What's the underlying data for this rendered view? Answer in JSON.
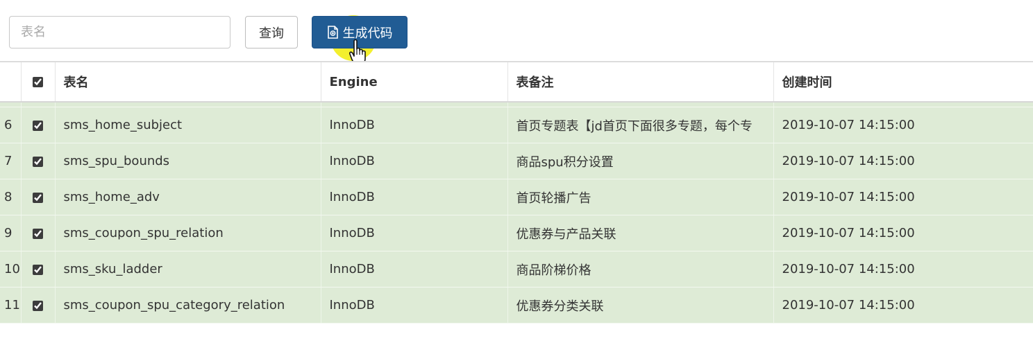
{
  "toolbar": {
    "search_placeholder": "表名",
    "query_label": "查询",
    "generate_label": "生成代码",
    "generate_icon": "document-code-icon",
    "highlight_color": "#f0eb00",
    "button_primary_color": "#215c94"
  },
  "table": {
    "headers": {
      "name": "表名",
      "engine": "Engine",
      "comment": "表备注",
      "created": "创建时间"
    },
    "header_checkbox_checked": true,
    "row_color": "#deebd6",
    "rows": [
      {
        "index": "6",
        "checked": true,
        "name": "sms_home_subject",
        "engine": "InnoDB",
        "comment": "首页专题表【jd首页下面很多专题，每个专",
        "created": "2019-10-07 14:15:00"
      },
      {
        "index": "7",
        "checked": true,
        "name": "sms_spu_bounds",
        "engine": "InnoDB",
        "comment": "商品spu积分设置",
        "created": "2019-10-07 14:15:00"
      },
      {
        "index": "8",
        "checked": true,
        "name": "sms_home_adv",
        "engine": "InnoDB",
        "comment": "首页轮播广告",
        "created": "2019-10-07 14:15:00"
      },
      {
        "index": "9",
        "checked": true,
        "name": "sms_coupon_spu_relation",
        "engine": "InnoDB",
        "comment": "优惠券与产品关联",
        "created": "2019-10-07 14:15:00"
      },
      {
        "index": "10",
        "checked": true,
        "name": "sms_sku_ladder",
        "engine": "InnoDB",
        "comment": "商品阶梯价格",
        "created": "2019-10-07 14:15:00"
      },
      {
        "index": "11",
        "checked": true,
        "name": "sms_coupon_spu_category_relation",
        "engine": "InnoDB",
        "comment": "优惠券分类关联",
        "created": "2019-10-07 14:15:00"
      }
    ]
  }
}
